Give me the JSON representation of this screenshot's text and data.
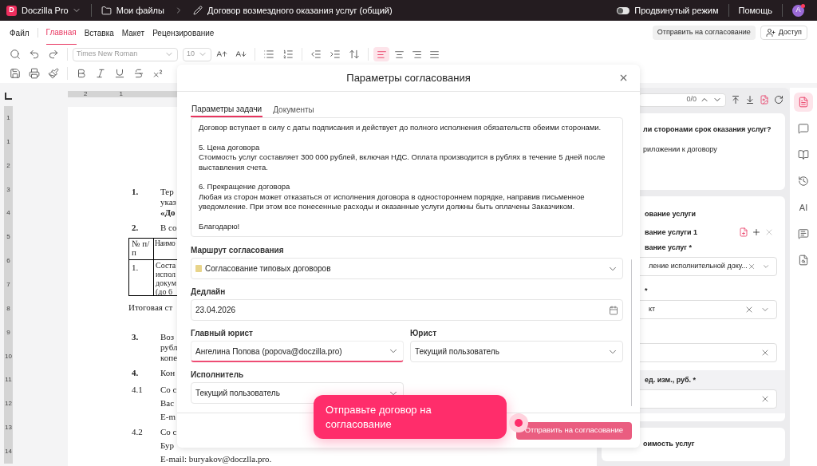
{
  "topbar": {
    "app": "Doczilla Pro",
    "logo": "D",
    "folder": "Мои файлы",
    "document": "Договор возмездного оказания услуг (общий)",
    "advanced_mode": {
      "label": "Продвинутый режим",
      "on": false
    },
    "help": "Помощь",
    "avatar": "A"
  },
  "menu": [
    {
      "label": "Файл",
      "selected": false
    },
    {
      "label": "Главная",
      "selected": true
    },
    {
      "label": "Вставка",
      "selected": false
    },
    {
      "label": "Макет",
      "selected": false
    },
    {
      "label": "Рецензирование",
      "selected": false
    }
  ],
  "header_buttons": [
    {
      "kind": "plain",
      "label": "Отправить на согласование"
    },
    {
      "kind": "share",
      "label": "Доступ"
    }
  ],
  "font": {
    "family": "Times New Roman",
    "size": "10"
  },
  "alignment": [
    {
      "kind": "left",
      "selected": true
    },
    {
      "kind": "center",
      "selected": false
    },
    {
      "kind": "right",
      "selected": false
    },
    {
      "kind": "justify",
      "selected": false
    }
  ],
  "rulers": {
    "horizontal": [
      "2",
      "1"
    ],
    "vertical": [
      "1",
      "1",
      "2",
      "3",
      "4",
      "5",
      "6",
      "7",
      "8",
      "9",
      "10",
      "11",
      "12",
      "13",
      "14"
    ]
  },
  "document": [
    {
      "kind": "item",
      "num": "1.",
      "lines": [
        "Тер",
        "указ"
      ],
      "emphasis": "«До"
    },
    {
      "kind": "item",
      "num": "2.",
      "lines": [
        "В со"
      ]
    },
    {
      "kind": "table",
      "header": [
        "№ п/п",
        "Наимо"
      ],
      "row": [
        "1.",
        "Соста",
        "испол",
        "докум",
        "(до 6"
      ]
    },
    {
      "kind": "text",
      "lines": [
        "Итоговая ст"
      ]
    },
    {
      "kind": "item",
      "num": "3.",
      "lines": [
        "Воз",
        "рубл",
        "копе"
      ]
    },
    {
      "kind": "item",
      "num": "4.",
      "lines": [
        "Кон"
      ]
    },
    {
      "kind": "sub",
      "num": "4.1",
      "lines": [
        "Со с",
        "Вас",
        "E-m"
      ]
    },
    {
      "kind": "sub",
      "num": "4.2",
      "lines": [
        "Со с",
        "Бур",
        "E-mail: buryakov@doczlla.pro."
      ]
    }
  ],
  "right_panel": {
    "counter": "0/0",
    "card1": {
      "question": "ли сторонами срок оказания услуг?",
      "answer": "риложении к договору"
    },
    "card2": {
      "title": "ование услуги",
      "subtitle": "вание услуги 1",
      "fields": [
        {
          "label": "вание услуг *",
          "value": "ление исполнительной доку...",
          "kind": "select",
          "highlighted": false
        },
        {
          "label": "*",
          "value": "кт",
          "kind": "select",
          "highlighted": false
        },
        {
          "kind": "input",
          "highlighted": false
        },
        {
          "label": "ед. изм., руб. *",
          "kind": "input",
          "highlighted": true
        }
      ]
    },
    "card3": {
      "title": "оимость услуг"
    }
  },
  "side_icons": [
    {
      "kind": "doc",
      "selected": true
    },
    {
      "kind": "comment",
      "selected": false
    },
    {
      "kind": "book",
      "selected": false
    },
    {
      "kind": "history",
      "selected": false
    },
    {
      "kind": "ai",
      "label": "AI",
      "selected": false
    },
    {
      "kind": "sign",
      "selected": false
    },
    {
      "kind": "review",
      "selected": false
    }
  ],
  "dialog": {
    "title": "Параметры согласования",
    "tabs": [
      {
        "label": "Параметры задачи",
        "selected": true
      },
      {
        "label": "Документы",
        "selected": false
      }
    ],
    "message": [
      [
        "Договор вступает в силу с даты подписания и действует до полного исполнения обязательств обеими сторонами."
      ],
      [
        "5. Цена договора",
        "Стоимость услуг составляет 300 000 рублей, включая НДС. Оплата производится в рублях в течение 5 дней после выставления счета."
      ],
      [
        "6. Прекращение договора",
        "Любая из сторон может отказаться от исполнения договора в одностороннем порядке, направив письменное уведомление. При этом все понесенные расходы и оказанные услуги должны быть оплачены Заказчиком."
      ],
      [
        "Благодарю!"
      ]
    ],
    "rows": [
      [
        {
          "label": "Маршрут согласования",
          "value": "Согласование типовых договоров",
          "kind": "route",
          "focused": false
        }
      ],
      [
        {
          "label": "Дедлайн",
          "value": "23.04.2026",
          "kind": "date",
          "focused": false
        }
      ],
      [
        {
          "label": "Главный юрист",
          "value": "Ангелина Попова (popova@doczilla.pro)",
          "kind": "select",
          "focused": true
        },
        {
          "label": "Юрист",
          "value": "Текущий пользователь",
          "kind": "select",
          "focused": false
        }
      ],
      [
        {
          "label": "Исполнитель",
          "value": "Текущий пользователь",
          "kind": "select",
          "focused": false
        }
      ]
    ],
    "submit": "Отправить на согласование"
  },
  "tooltip": {
    "text": "Отправьте договор на согласование"
  }
}
